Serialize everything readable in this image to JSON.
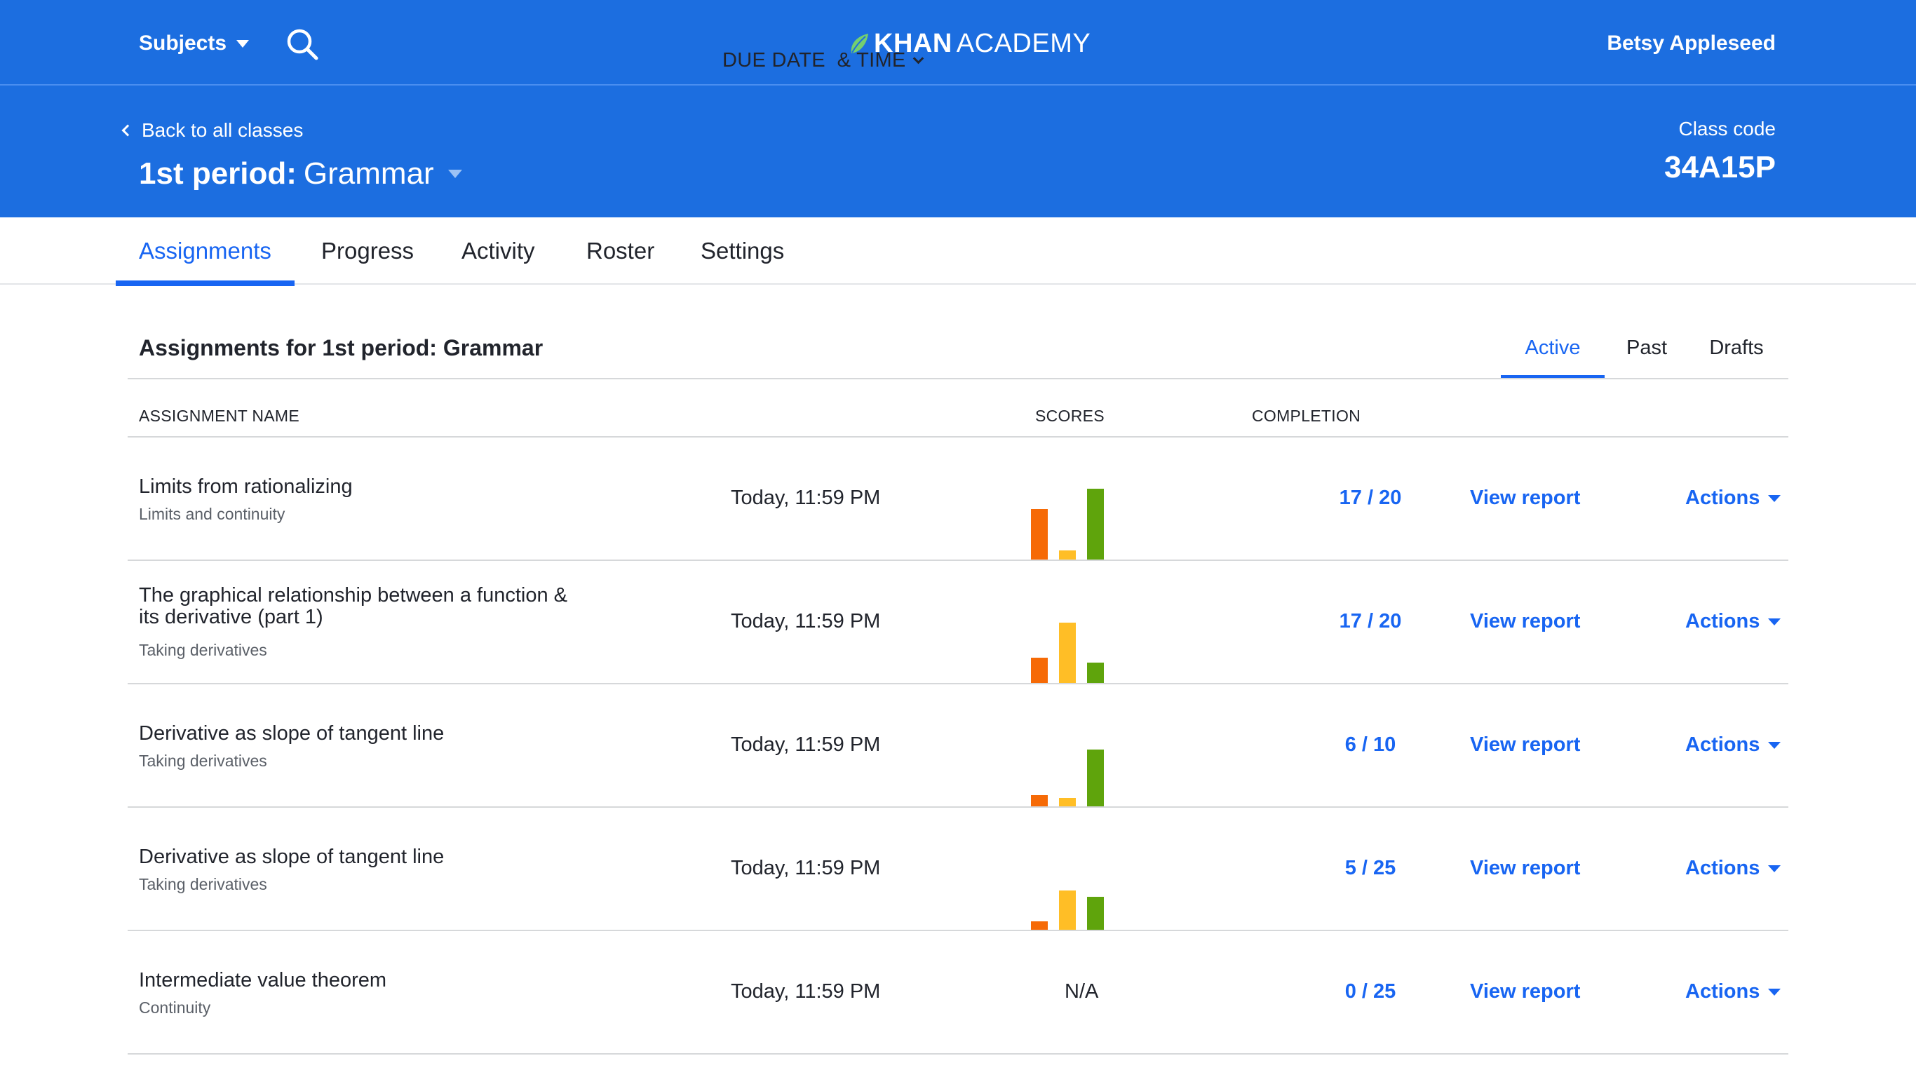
{
  "header": {
    "subjects_label": "Subjects",
    "logo_khan": "KHAN",
    "logo_academy": "ACADEMY",
    "user_name": "Betsy Appleseed"
  },
  "class_header": {
    "back_label": "Back to all classes",
    "period": "1st period:",
    "subject": "Grammar",
    "code_label": "Class code",
    "code_value": "34A15P"
  },
  "nav_tabs": [
    {
      "label": "Assignments",
      "active": true
    },
    {
      "label": "Progress",
      "active": false
    },
    {
      "label": "Activity",
      "active": false
    },
    {
      "label": "Roster",
      "active": false
    },
    {
      "label": "Settings",
      "active": false
    }
  ],
  "section": {
    "title": "Assignments for 1st period: Grammar",
    "filters": [
      {
        "label": "Active",
        "active": true
      },
      {
        "label": "Past",
        "active": false
      },
      {
        "label": "Drafts",
        "active": false
      }
    ]
  },
  "table": {
    "columns": {
      "name": "ASSIGNMENT NAME",
      "due": "DUE DATE  & TIME",
      "scores": "SCORES",
      "completion": "COMPLETION"
    },
    "view_report_label": "View report",
    "actions_label": "Actions",
    "rows": [
      {
        "name": "Limits from rationalizing",
        "subtitle": "Limits and continuity",
        "due": "Today, 11:59 PM",
        "scores": [
          0.55,
          0.1,
          0.78
        ],
        "completion": "17 / 20"
      },
      {
        "name": "The graphical relationship between a function & its derivative (part 1)",
        "subtitle": "Taking derivatives",
        "due": "Today, 11:59 PM",
        "scores": [
          0.28,
          0.66,
          0.22
        ],
        "completion": "17 / 20"
      },
      {
        "name": "Derivative as slope of tangent line",
        "subtitle": "Taking derivatives",
        "due": "Today, 11:59 PM",
        "scores": [
          0.12,
          0.09,
          0.62
        ],
        "completion": "6 / 10"
      },
      {
        "name": "Derivative as slope of tangent line",
        "subtitle": "Taking derivatives",
        "due": "Today, 11:59 PM",
        "scores": [
          0.09,
          0.43,
          0.36
        ],
        "completion": "5 / 25"
      },
      {
        "name": "Intermediate value theorem",
        "subtitle": "Continuity",
        "due": "Today, 11:59 PM",
        "scores_text": "N/A",
        "completion": "0 / 25"
      }
    ]
  },
  "colors": {
    "brand_blue": "#1c6ee0",
    "link_blue": "#1865f2",
    "score_low": "#f66a06",
    "score_mid": "#ffbe26",
    "score_high": "#5fa40c",
    "leaf_green": "#74cf70"
  },
  "icons": {
    "search": "search-icon",
    "logo_leaf": "leaf-icon",
    "dropdown": "caret-down-icon",
    "back": "chevron-left-icon",
    "sort": "chevron-down-icon"
  }
}
